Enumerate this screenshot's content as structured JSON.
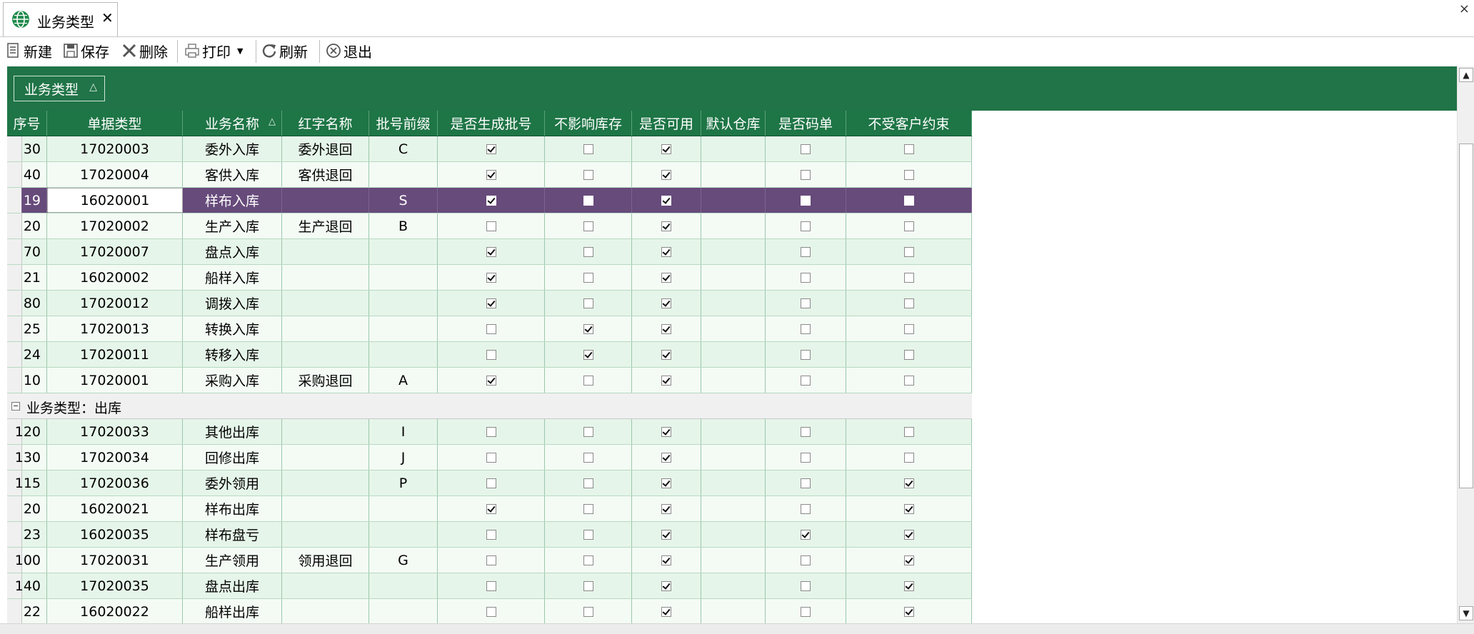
{
  "tab": {
    "title": "业务类型",
    "close": "✕"
  },
  "window": {
    "close": "×"
  },
  "toolbar": {
    "new_label": "新建",
    "save_label": "保存",
    "delete_label": "删除",
    "print_label": "打印",
    "refresh_label": "刷新",
    "exit_label": "退出"
  },
  "group_panel": {
    "chip_label": "业务类型",
    "chip_sort": "△"
  },
  "columns": [
    {
      "key": "seq",
      "label": "序号"
    },
    {
      "key": "doc",
      "label": "单据类型"
    },
    {
      "key": "name",
      "label": "业务名称",
      "sort": "△"
    },
    {
      "key": "red",
      "label": "红字名称"
    },
    {
      "key": "prefix",
      "label": "批号前缀"
    },
    {
      "key": "gen_batch",
      "label": "是否生成批号"
    },
    {
      "key": "no_stock",
      "label": "不影响库存"
    },
    {
      "key": "enabled",
      "label": "是否可用"
    },
    {
      "key": "warehouse",
      "label": "默认仓库"
    },
    {
      "key": "code_doc",
      "label": "是否码单"
    },
    {
      "key": "no_customer",
      "label": "不受客户约束"
    }
  ],
  "rows": [
    {
      "seq": "30",
      "doc": "17020003",
      "name": "委外入库",
      "red": "委外退回",
      "prefix": "C",
      "gen_batch": true,
      "no_stock": false,
      "enabled": true,
      "warehouse": "",
      "code_doc": false,
      "no_customer": false
    },
    {
      "seq": "40",
      "doc": "17020004",
      "name": "客供入库",
      "red": "客供退回",
      "prefix": "",
      "gen_batch": true,
      "no_stock": false,
      "enabled": true,
      "warehouse": "",
      "code_doc": false,
      "no_customer": false
    },
    {
      "seq": "19",
      "doc": "16020001",
      "name": "样布入库",
      "red": "",
      "prefix": "S",
      "gen_batch": true,
      "no_stock": false,
      "enabled": true,
      "warehouse": "",
      "code_doc": false,
      "no_customer": false,
      "selected": true
    },
    {
      "seq": "20",
      "doc": "17020002",
      "name": "生产入库",
      "red": "生产退回",
      "prefix": "B",
      "gen_batch": false,
      "no_stock": false,
      "enabled": true,
      "warehouse": "",
      "code_doc": false,
      "no_customer": false
    },
    {
      "seq": "70",
      "doc": "17020007",
      "name": "盘点入库",
      "red": "",
      "prefix": "",
      "gen_batch": true,
      "no_stock": false,
      "enabled": true,
      "warehouse": "",
      "code_doc": false,
      "no_customer": false
    },
    {
      "seq": "21",
      "doc": "16020002",
      "name": "船样入库",
      "red": "",
      "prefix": "",
      "gen_batch": true,
      "no_stock": false,
      "enabled": true,
      "warehouse": "",
      "code_doc": false,
      "no_customer": false
    },
    {
      "seq": "80",
      "doc": "17020012",
      "name": "调拨入库",
      "red": "",
      "prefix": "",
      "gen_batch": true,
      "no_stock": false,
      "enabled": true,
      "warehouse": "",
      "code_doc": false,
      "no_customer": false
    },
    {
      "seq": "25",
      "doc": "17020013",
      "name": "转换入库",
      "red": "",
      "prefix": "",
      "gen_batch": false,
      "no_stock": true,
      "enabled": true,
      "warehouse": "",
      "code_doc": false,
      "no_customer": false
    },
    {
      "seq": "24",
      "doc": "17020011",
      "name": "转移入库",
      "red": "",
      "prefix": "",
      "gen_batch": false,
      "no_stock": true,
      "enabled": true,
      "warehouse": "",
      "code_doc": false,
      "no_customer": false
    },
    {
      "seq": "10",
      "doc": "17020001",
      "name": "采购入库",
      "red": "采购退回",
      "prefix": "A",
      "gen_batch": true,
      "no_stock": false,
      "enabled": true,
      "warehouse": "",
      "code_doc": false,
      "no_customer": false
    },
    {
      "group": "业务类型：出库"
    },
    {
      "seq": "120",
      "doc": "17020033",
      "name": "其他出库",
      "red": "",
      "prefix": "I",
      "gen_batch": false,
      "no_stock": false,
      "enabled": true,
      "warehouse": "",
      "code_doc": false,
      "no_customer": false
    },
    {
      "seq": "130",
      "doc": "17020034",
      "name": "回修出库",
      "red": "",
      "prefix": "J",
      "gen_batch": false,
      "no_stock": false,
      "enabled": true,
      "warehouse": "",
      "code_doc": false,
      "no_customer": false
    },
    {
      "seq": "115",
      "doc": "17020036",
      "name": "委外领用",
      "red": "",
      "prefix": "P",
      "gen_batch": false,
      "no_stock": false,
      "enabled": true,
      "warehouse": "",
      "code_doc": false,
      "no_customer": true
    },
    {
      "seq": "20",
      "doc": "16020021",
      "name": "样布出库",
      "red": "",
      "prefix": "",
      "gen_batch": true,
      "no_stock": false,
      "enabled": true,
      "warehouse": "",
      "code_doc": false,
      "no_customer": true
    },
    {
      "seq": "23",
      "doc": "16020035",
      "name": "样布盘亏",
      "red": "",
      "prefix": "",
      "gen_batch": false,
      "no_stock": false,
      "enabled": true,
      "warehouse": "",
      "code_doc": true,
      "no_customer": true
    },
    {
      "seq": "100",
      "doc": "17020031",
      "name": "生产领用",
      "red": "领用退回",
      "prefix": "G",
      "gen_batch": false,
      "no_stock": false,
      "enabled": true,
      "warehouse": "",
      "code_doc": false,
      "no_customer": true
    },
    {
      "seq": "140",
      "doc": "17020035",
      "name": "盘点出库",
      "red": "",
      "prefix": "",
      "gen_batch": false,
      "no_stock": false,
      "enabled": true,
      "warehouse": "",
      "code_doc": false,
      "no_customer": true
    },
    {
      "seq": "22",
      "doc": "16020022",
      "name": "船样出库",
      "red": "",
      "prefix": "",
      "gen_batch": false,
      "no_stock": false,
      "enabled": true,
      "warehouse": "",
      "code_doc": false,
      "no_customer": true
    }
  ],
  "scrollbar": {
    "up": "▲",
    "down": "▼"
  },
  "colors": {
    "header_green": "#1e7546",
    "selected_row": "#674b7b",
    "row_even": "#e6f5e9",
    "row_odd": "#f4fbf5"
  },
  "icons": [
    "globe-icon",
    "new-doc-icon",
    "save-icon",
    "delete-icon",
    "print-icon",
    "dropdown-arrow-icon",
    "refresh-icon",
    "exit-icon",
    "collapse-icon"
  ]
}
